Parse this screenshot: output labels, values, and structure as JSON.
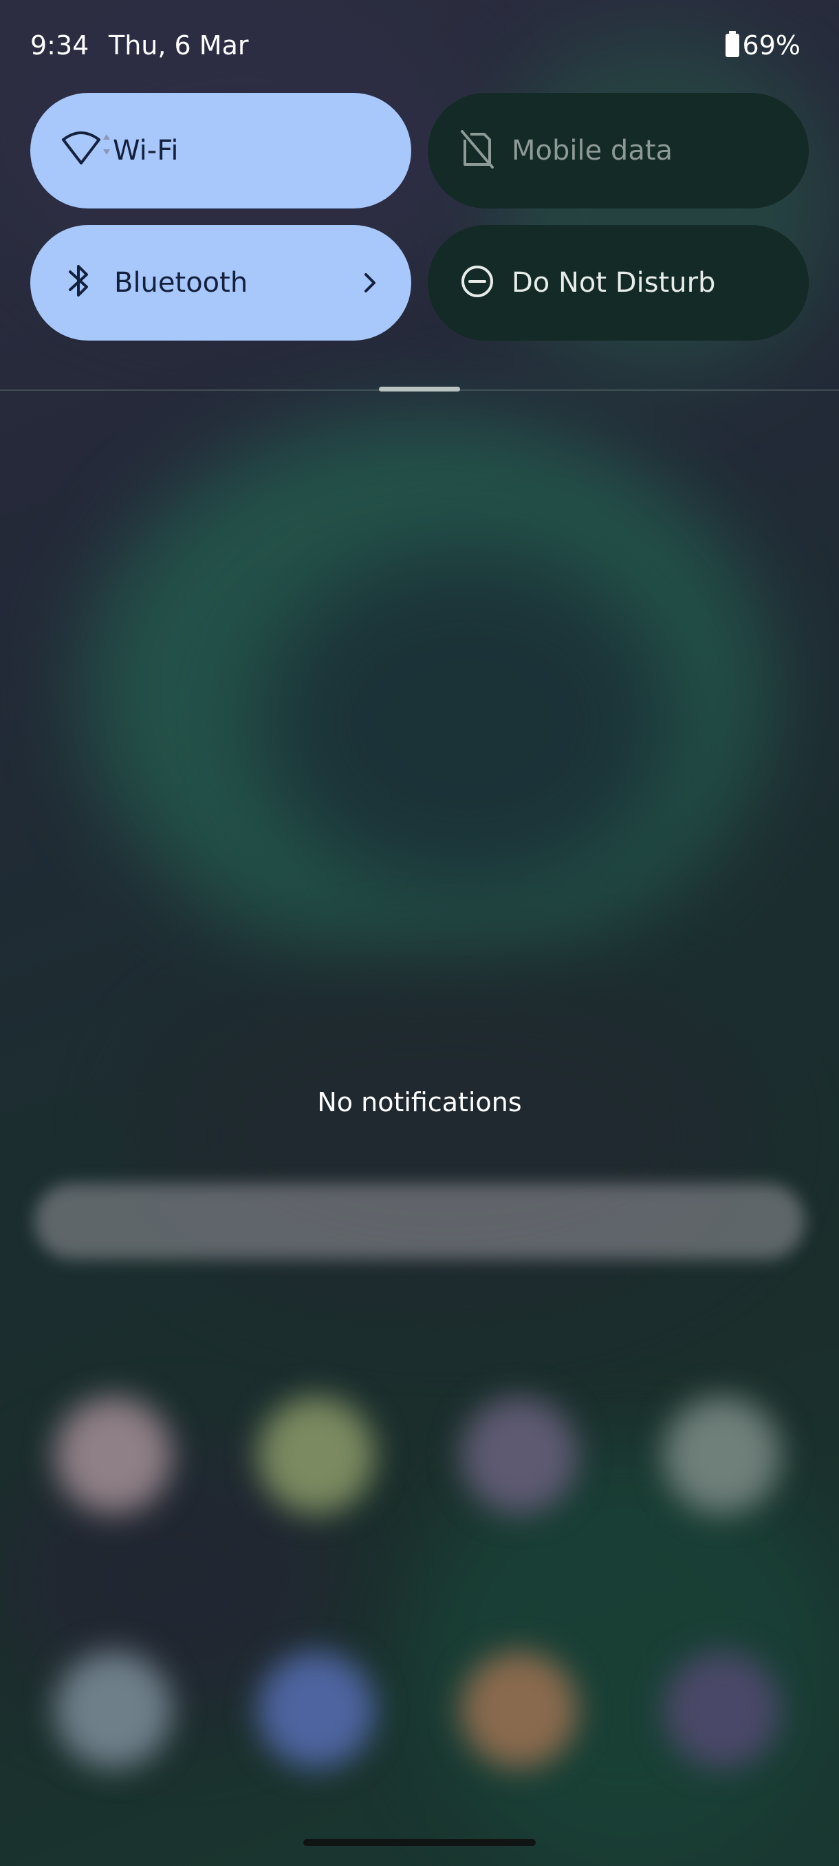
{
  "status_bar": {
    "time": "9:34",
    "date": "Thu, 6 Mar",
    "battery_percent": "69%"
  },
  "quick_settings": {
    "tiles": [
      {
        "label": "Wi-Fi",
        "state": "on",
        "icon": "wifi-icon"
      },
      {
        "label": "Mobile data",
        "state": "unavailable",
        "icon": "no-sim-icon"
      },
      {
        "label": "Bluetooth",
        "state": "on",
        "icon": "bluetooth-icon"
      },
      {
        "label": "Do Not Disturb",
        "state": "off",
        "icon": "do-not-disturb-icon"
      }
    ]
  },
  "notifications": {
    "empty_text": "No notifications"
  },
  "colors": {
    "tile_on": "#a8c7fa",
    "tile_off": "#132a26"
  }
}
